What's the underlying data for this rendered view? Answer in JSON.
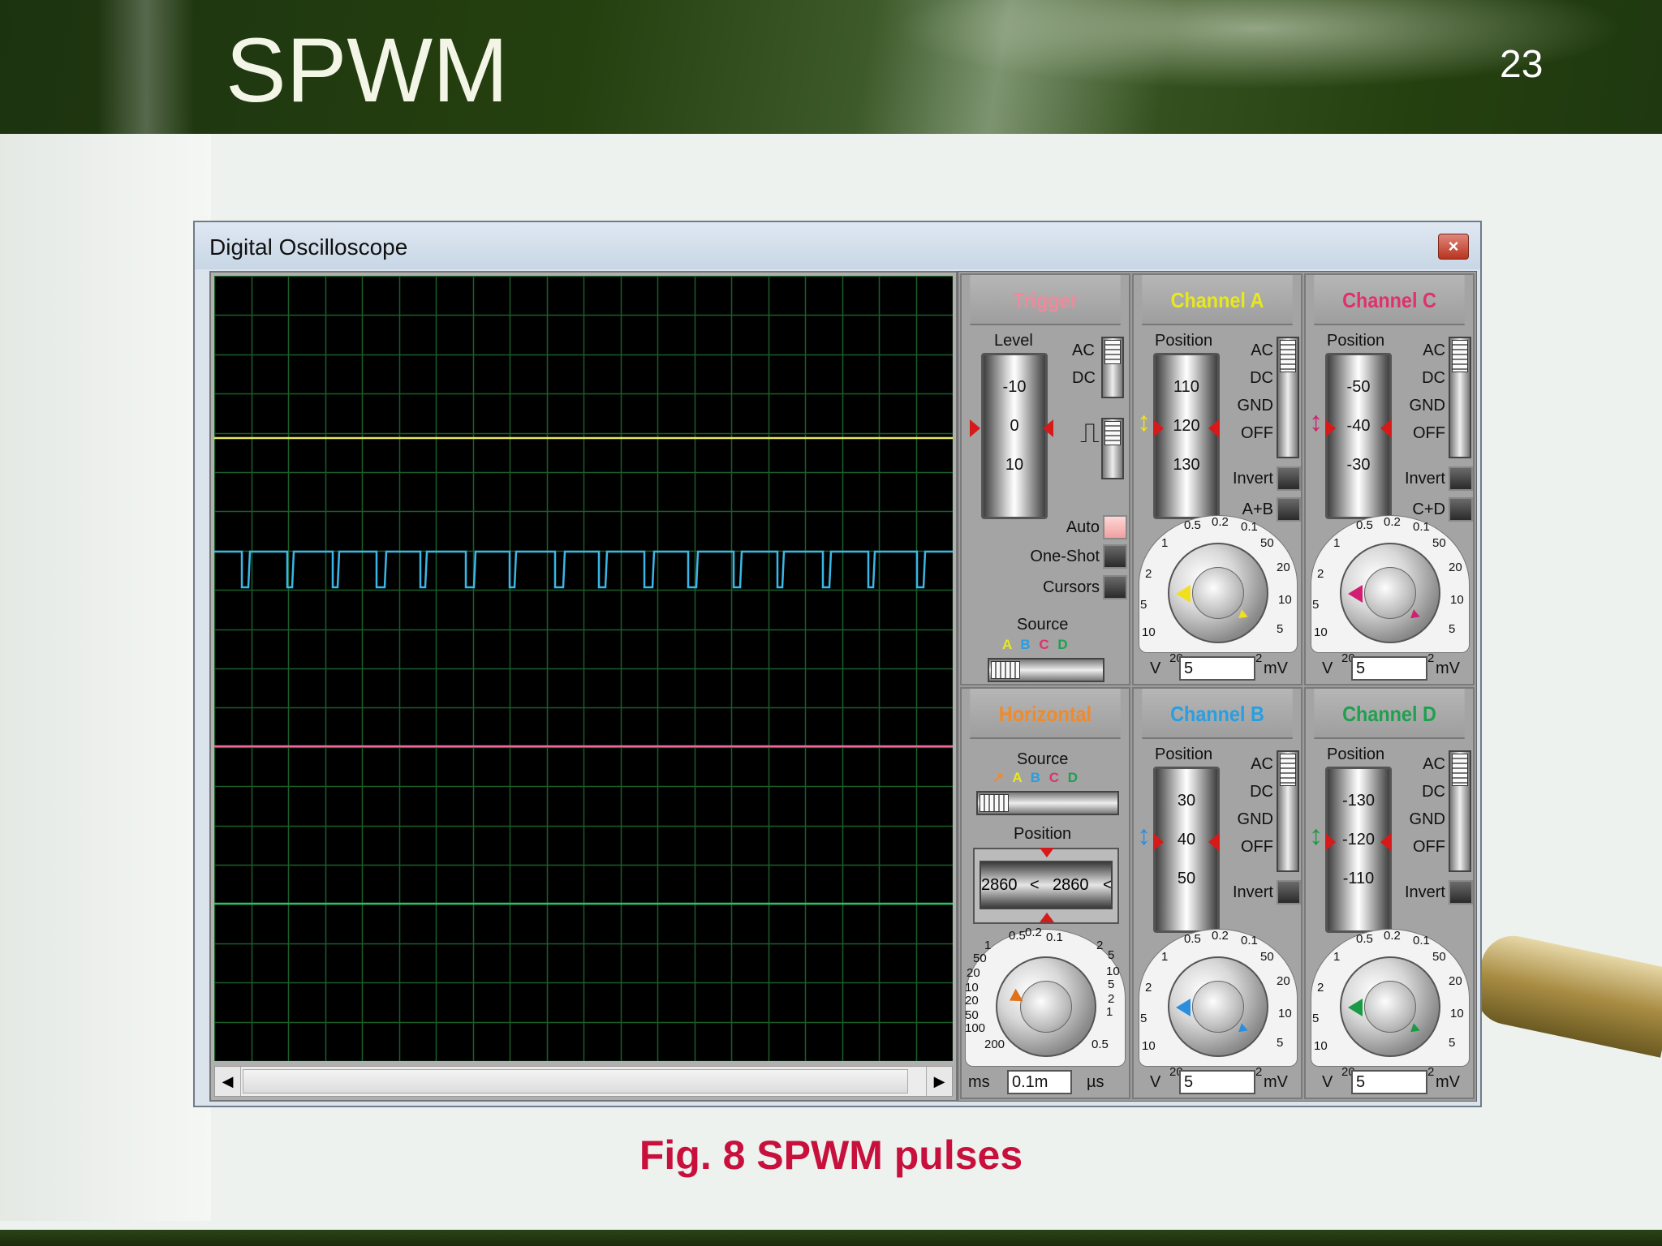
{
  "slide": {
    "title": "SPWM",
    "number": "23",
    "caption": "Fig. 8 SPWM pulses"
  },
  "window": {
    "title": "Digital Oscilloscope",
    "close_icon": "close-icon"
  },
  "trace_colors": {
    "channel_a": "#e8e85a",
    "channel_b": "#3ab7e6",
    "channel_c": "#ee6aa0",
    "channel_d": "#2fbf6a",
    "grid": "#1b5e28",
    "background": "#000000"
  },
  "trigger": {
    "header": "Trigger",
    "header_color": "#f08a9a",
    "level_label": "Level",
    "level_scale": [
      "-10",
      "0",
      "10"
    ],
    "ac_label": "AC",
    "dc_label": "DC",
    "auto_label": "Auto",
    "one_shot_label": "One-Shot",
    "cursors_label": "Cursors",
    "source_label": "Source",
    "source_letters": [
      "A",
      "B",
      "C",
      "D"
    ]
  },
  "channel_a": {
    "header": "Channel A",
    "header_color": "#e8e81e",
    "position_label": "Position",
    "scale": [
      "110",
      "120",
      "130"
    ],
    "coupling": [
      "AC",
      "DC",
      "GND",
      "OFF"
    ],
    "invert_label": "Invert",
    "combine_label": "A+B",
    "knob_ticks": [
      "0.5",
      "0.2",
      "0.1",
      "1",
      "50",
      "2",
      "20",
      "5",
      "10",
      "10",
      "5",
      "20",
      "2"
    ],
    "unit_left": "V",
    "value": "5",
    "unit_right": "mV",
    "marker_color": "#f0e020"
  },
  "channel_c": {
    "header": "Channel C",
    "header_color": "#e0306e",
    "position_label": "Position",
    "scale": [
      "-50",
      "-40",
      "-30"
    ],
    "coupling": [
      "AC",
      "DC",
      "GND",
      "OFF"
    ],
    "invert_label": "Invert",
    "combine_label": "C+D",
    "knob_ticks": [
      "0.5",
      "0.2",
      "0.1",
      "1",
      "50",
      "2",
      "20",
      "5",
      "10",
      "10",
      "5",
      "20",
      "2"
    ],
    "unit_left": "V",
    "value": "5",
    "unit_right": "mV",
    "marker_color": "#d21e72"
  },
  "horizontal": {
    "header": "Horizontal",
    "header_color": "#f08a2a",
    "source_label": "Source",
    "source_letters": [
      "A",
      "B",
      "C",
      "D"
    ],
    "position_label": "Position",
    "position_readout_left": "2860",
    "position_readout_arrow": "<",
    "position_readout": "2860",
    "position_readout_right": "<",
    "knob_ticks": [
      "0.5",
      "0.2",
      "0.1",
      "1",
      "2",
      "50",
      "5",
      "20",
      "10",
      "10",
      "20",
      "5",
      "50",
      "2",
      "100",
      "1",
      "200",
      "0.5"
    ],
    "unit_left": "ms",
    "value": "0.1m",
    "unit_right": "µs",
    "marker_color": "#e0701a"
  },
  "channel_b": {
    "header": "Channel B",
    "header_color": "#2a9ee0",
    "position_label": "Position",
    "scale": [
      "30",
      "40",
      "50"
    ],
    "coupling": [
      "AC",
      "DC",
      "GND",
      "OFF"
    ],
    "invert_label": "Invert",
    "knob_ticks": [
      "0.5",
      "0.2",
      "0.1",
      "1",
      "50",
      "2",
      "20",
      "5",
      "10",
      "10",
      "5",
      "20",
      "2"
    ],
    "unit_left": "V",
    "value": "5",
    "unit_right": "mV",
    "marker_color": "#2a8ee0"
  },
  "channel_d": {
    "header": "Channel D",
    "header_color": "#1fa050",
    "position_label": "Position",
    "scale": [
      "-130",
      "-120",
      "-110"
    ],
    "coupling": [
      "AC",
      "DC",
      "GND",
      "OFF"
    ],
    "invert_label": "Invert",
    "knob_ticks": [
      "0.5",
      "0.2",
      "0.1",
      "1",
      "50",
      "2",
      "20",
      "5",
      "10",
      "10",
      "5",
      "20",
      "2"
    ],
    "unit_left": "V",
    "value": "5",
    "unit_right": "mV",
    "marker_color": "#1a9a44"
  }
}
